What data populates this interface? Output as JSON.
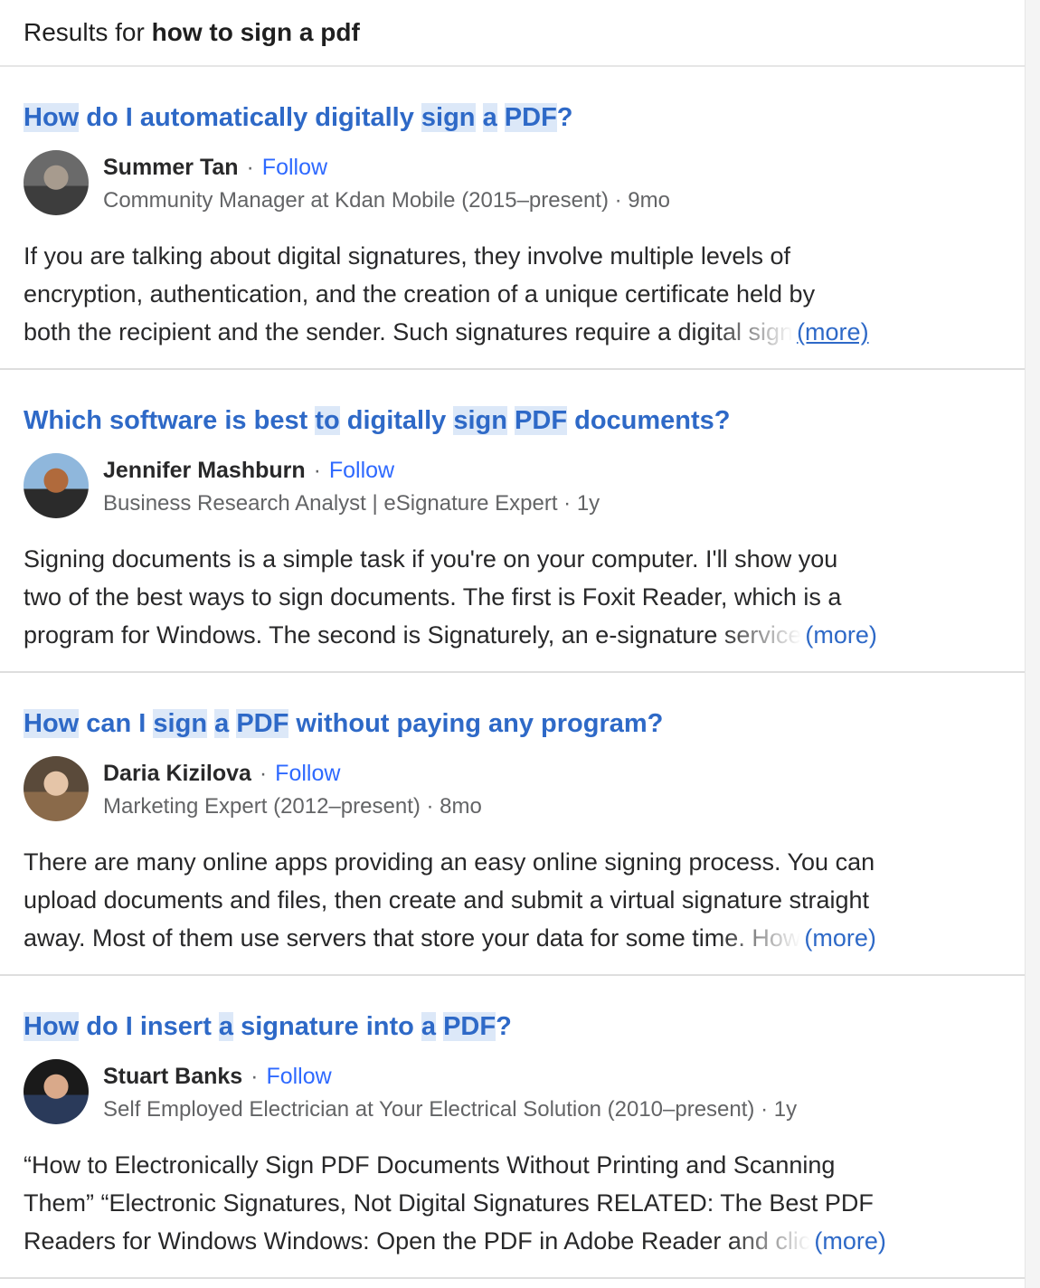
{
  "header": {
    "prefix": "Results for",
    "query": "how to sign a pdf"
  },
  "follow_label": "Follow",
  "more_label": "(more)",
  "results": [
    {
      "title_parts": [
        [
          "How",
          true
        ],
        [
          " do I automatically digitally ",
          false
        ],
        [
          "sign",
          true
        ],
        [
          " ",
          false
        ],
        [
          "a",
          true
        ],
        [
          " ",
          false
        ],
        [
          "PDF",
          true
        ],
        [
          "?",
          false
        ]
      ],
      "author": "Summer Tan",
      "credential": "Community Manager at Kdan Mobile (2015–present) · 9mo",
      "lines": [
        "If you are talking about digital signatures, they involve multiple levels of",
        "encryption, authentication, and the creation of a unique certificate held by",
        "both the recipient and the sender. Such signatures require a digital sign"
      ],
      "avatar_colors": [
        "#6a6a6a",
        "#a79b8e",
        "#3d3d3d"
      ]
    },
    {
      "title_parts": [
        [
          "Which software is best ",
          false
        ],
        [
          "to",
          true
        ],
        [
          " digitally ",
          false
        ],
        [
          "sign",
          true
        ],
        [
          " ",
          false
        ],
        [
          "PDF",
          true
        ],
        [
          " documents?",
          false
        ]
      ],
      "author": "Jennifer Mashburn",
      "credential": "Business Research Analyst | eSignature Expert · 1y",
      "lines": [
        "Signing documents is a simple task if you're on your computer. I'll show you",
        "two of the best ways to sign documents. The first is Foxit Reader, which is a",
        "program for Windows. The second is Signaturely, an e-signature service"
      ],
      "avatar_colors": [
        "#8fb7dc",
        "#b06a3c",
        "#2b2b2b"
      ]
    },
    {
      "title_parts": [
        [
          "How",
          true
        ],
        [
          " can I ",
          false
        ],
        [
          "sign",
          true
        ],
        [
          " ",
          false
        ],
        [
          "a",
          true
        ],
        [
          " ",
          false
        ],
        [
          "PDF",
          true
        ],
        [
          " without paying any program?",
          false
        ]
      ],
      "author": "Daria Kizilova",
      "credential": "Marketing Expert (2012–present) · 8mo",
      "lines": [
        "There are many online apps providing an easy online signing process. You can",
        "upload documents and files, then create and submit a virtual signature straight",
        "away. Most of them use servers that store your data for some time. How"
      ],
      "avatar_colors": [
        "#5a4a3a",
        "#e5c5a8",
        "#8a6a4a"
      ]
    },
    {
      "title_parts": [
        [
          "How",
          true
        ],
        [
          " do I insert ",
          false
        ],
        [
          "a",
          true
        ],
        [
          " signature into ",
          false
        ],
        [
          "a",
          true
        ],
        [
          " ",
          false
        ],
        [
          "PDF",
          true
        ],
        [
          "?",
          false
        ]
      ],
      "author": "Stuart Banks",
      "credential": "Self Employed Electrician at Your Electrical Solution (2010–present) · 1y",
      "lines": [
        "“How to Electronically Sign PDF Documents Without Printing and Scanning",
        "Them” “Electronic Signatures, Not Digital Signatures RELATED: The Best PDF",
        "Readers for Windows Windows: Open the PDF in Adobe Reader and clic"
      ],
      "avatar_colors": [
        "#1a1a1a",
        "#d9a98a",
        "#2a3a5a"
      ]
    }
  ]
}
